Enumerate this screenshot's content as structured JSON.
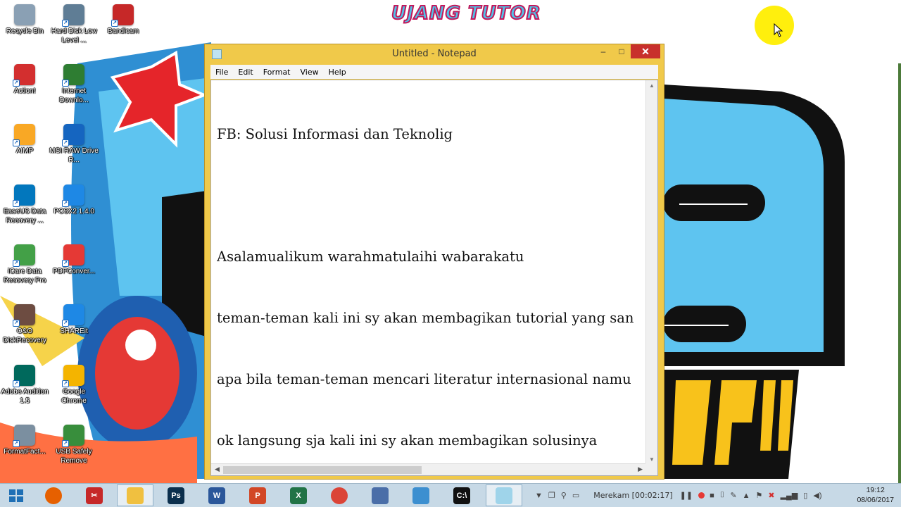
{
  "wallpaper": {
    "title_text": "UJANG TUTOR",
    "accent_colors": {
      "blue": "#3aa8dc",
      "red": "#e5252a",
      "yellow": "#f8c21b",
      "dark": "#111111"
    }
  },
  "desktop_icons": [
    {
      "label": "Recycle Bin",
      "icon": "recycle-bin-icon",
      "color": "#8aa0b4"
    },
    {
      "label": "Hard Disk Low Level ...",
      "icon": "hard-disk-icon",
      "color": "#5f7d95"
    },
    {
      "label": "Bandicam",
      "icon": "bandicam-icon",
      "color": "#c62828"
    },
    {
      "label": "Action!",
      "icon": "action-icon",
      "color": "#d32f2f"
    },
    {
      "label": "Internet Downlo...",
      "icon": "idm-icon",
      "color": "#2e7d32"
    },
    {
      "label": "AIMP",
      "icon": "aimp-icon",
      "color": "#f9a825"
    },
    {
      "label": "MSI RAW Drive R...",
      "icon": "msi-icon",
      "color": "#1565c0"
    },
    {
      "label": "EaseUS Data Recovery ...",
      "icon": "easeus-icon",
      "color": "#0277bd"
    },
    {
      "label": "PCSX2 1.4.0",
      "icon": "pcsx2-icon",
      "color": "#1e88e5"
    },
    {
      "label": "iCare Data Recovery Pro",
      "icon": "icare-icon",
      "color": "#43a047"
    },
    {
      "label": "PDFConver...",
      "icon": "pdf-converter-icon",
      "color": "#e53935"
    },
    {
      "label": "O&O DiskRecovery",
      "icon": "oo-disk-recovery-icon",
      "color": "#6d4c41"
    },
    {
      "label": "SHAREit",
      "icon": "shareit-icon",
      "color": "#1e88e5"
    },
    {
      "label": "Adobe Audition 1.5",
      "icon": "adobe-audition-icon",
      "color": "#00695c"
    },
    {
      "label": "Google Chrome",
      "icon": "chrome-icon",
      "color": "#f4b400"
    },
    {
      "label": "FormatFact...",
      "icon": "format-factory-icon",
      "color": "#7b8fa0"
    },
    {
      "label": "USB Safely Remove",
      "icon": "usb-icon",
      "color": "#388e3c"
    }
  ],
  "notepad": {
    "title": "Untitled - Notepad",
    "controls": {
      "minimize": "–",
      "maximize": "□",
      "close": "✕"
    },
    "menu": [
      "File",
      "Edit",
      "Format",
      "View",
      "Help"
    ],
    "content_lines": [
      "FB: Solusi Informasi dan Teknolig",
      "",
      "Asalamualikum warahmatulaihi wabarakatu",
      "teman-teman kali ini sy akan membagikan tutorial yang san",
      "apa bila teman-teman mencari literatur internasional namu",
      "ok langsung sja kali ini sy akan membagikan solusinya"
    ]
  },
  "taskbar": {
    "pinned": [
      {
        "name": "firefox",
        "label": "",
        "color": "#e66000",
        "active": false
      },
      {
        "name": "snipping-tool",
        "label": "✂",
        "color": "#c62828",
        "active": false
      },
      {
        "name": "file-explorer",
        "label": "",
        "color": "#f0c040",
        "active": true
      },
      {
        "name": "photoshop",
        "label": "Ps",
        "color": "#0b2f4d",
        "active": false
      },
      {
        "name": "word",
        "label": "W",
        "color": "#2b579a",
        "active": false
      },
      {
        "name": "powerpoint",
        "label": "P",
        "color": "#d24726",
        "active": false
      },
      {
        "name": "excel",
        "label": "X",
        "color": "#217346",
        "active": false
      },
      {
        "name": "chrome",
        "label": "",
        "color": "#db4437",
        "active": false
      },
      {
        "name": "network-app",
        "label": "",
        "color": "#4a6ea8",
        "active": false
      },
      {
        "name": "ppsspp",
        "label": "",
        "color": "#3c8fd0",
        "active": false
      },
      {
        "name": "command-prompt",
        "label": "C:\\",
        "color": "#111111",
        "active": false
      },
      {
        "name": "notepad",
        "label": "",
        "color": "#9fd4ea",
        "active": true
      }
    ],
    "recording_label": "Merekam [00:02:17]",
    "clock_time": "19:12",
    "clock_date": "08/06/2017"
  }
}
